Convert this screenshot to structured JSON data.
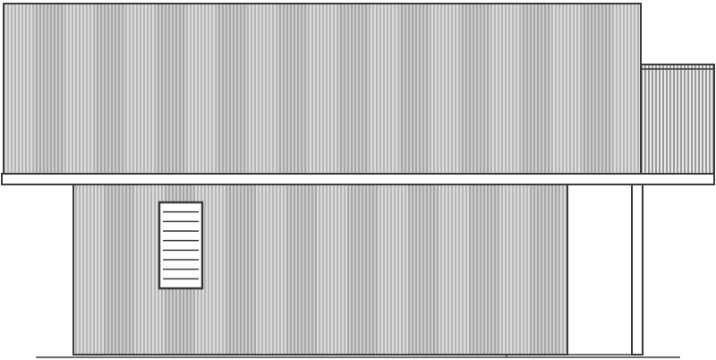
{
  "drawing": {
    "line_color": "#3a3a3a",
    "siding_light": "#cfcfcf",
    "siding_mid": "#b4b4b4",
    "background": "#ffffff",
    "window_slat_count": 8
  }
}
